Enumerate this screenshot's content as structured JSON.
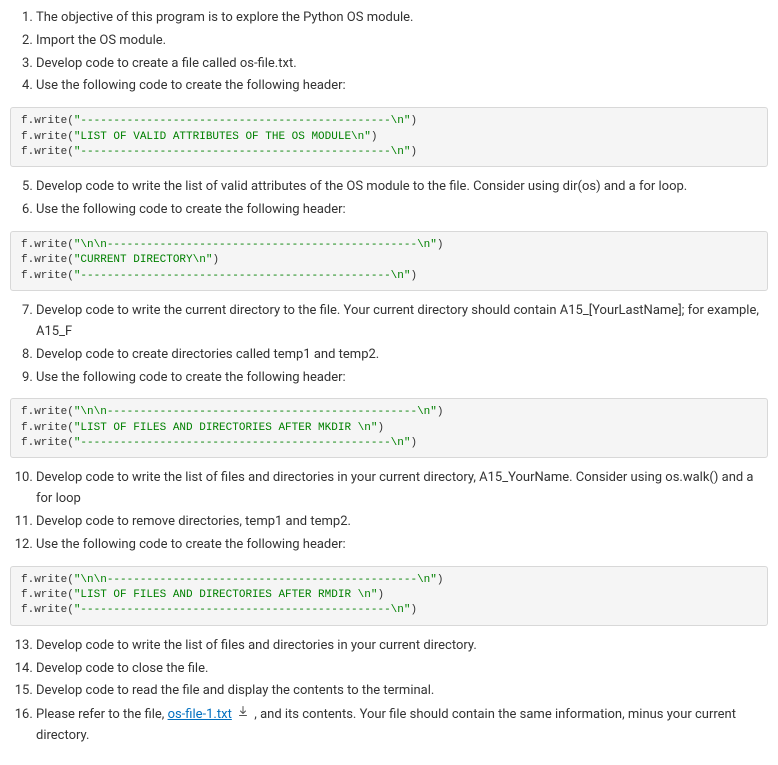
{
  "steps": {
    "s1": "The objective of this program is to explore the Python OS module.",
    "s2": "Import the OS module.",
    "s3": "Develop code to create a file called os-file.txt.",
    "s4": "Use the following code to create the following header:",
    "s5": "Develop code to write the list of valid attributes of the OS module to the file. Consider using dir(os) and a for loop.",
    "s6": "Use the following code to create the following header:",
    "s7": "Develop code to write the current directory to the file. Your current directory should contain A15_[YourLastName]; for example, A15_F",
    "s8": "Develop code to create directories called temp1 and temp2.",
    "s9": "Use the following code to create the following header:",
    "s10": "Develop code to write the list of files and directories in your current directory, A15_YourName. Consider using os.walk() and a for loop",
    "s11": "Develop code to remove directories, temp1 and temp2.",
    "s12": "Use the following code to create the following header:",
    "s13": "Develop code to write the list of files and directories in your current directory.",
    "s14": "Develop code to close the file.",
    "s15": "Develop code to read the file and display the contents to the terminal.",
    "s16a": "Please refer to the file, ",
    "s16link": "os-file-1.txt",
    "s16b": " , and its contents. Your file should contain the same information, minus your current directory."
  },
  "code": {
    "block1": {
      "l1a": "f.write(",
      "l1b": "\"-----------------------------------------------\\n\"",
      "l1c": ")",
      "l2a": "f.write(",
      "l2b": "\"LIST OF VALID ATTRIBUTES OF THE OS MODULE\\n\"",
      "l2c": ")",
      "l3a": "f.write(",
      "l3b": "\"-----------------------------------------------\\n\"",
      "l3c": ")"
    },
    "block2": {
      "l1a": "f.write(",
      "l1b": "\"\\n\\n-----------------------------------------------\\n\"",
      "l1c": ")",
      "l2a": "f.write(",
      "l2b": "\"CURRENT DIRECTORY\\n\"",
      "l2c": ")",
      "l3a": "f.write(",
      "l3b": "\"-----------------------------------------------\\n\"",
      "l3c": ")"
    },
    "block3": {
      "l1a": "f.write(",
      "l1b": "\"\\n\\n-----------------------------------------------\\n\"",
      "l1c": ")",
      "l2a": "f.write(",
      "l2b": "\"LIST OF FILES AND DIRECTORIES AFTER MKDIR \\n\"",
      "l2c": ")",
      "l3a": "f.write(",
      "l3b": "\"-----------------------------------------------\\n\"",
      "l3c": ")"
    },
    "block4": {
      "l1a": "f.write(",
      "l1b": "\"\\n\\n-----------------------------------------------\\n\"",
      "l1c": ")",
      "l2a": "f.write(",
      "l2b": "\"LIST OF FILES AND DIRECTORIES AFTER RMDIR \\n\"",
      "l2c": ")",
      "l3a": "f.write(",
      "l3b": "\"-----------------------------------------------\\n\"",
      "l3c": ")"
    }
  }
}
